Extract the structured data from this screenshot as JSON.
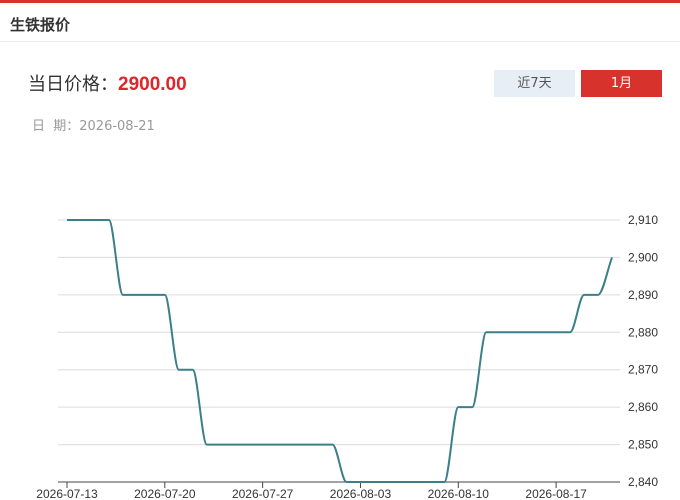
{
  "header": {
    "title": "生铁报价"
  },
  "price": {
    "label": "当日价格：",
    "value": "2900.00"
  },
  "date": {
    "label": "日  期：",
    "value": "2026-08-21"
  },
  "tabs": {
    "week_label": "近7天",
    "month_label": "1月",
    "active": "1月"
  },
  "colors": {
    "accent": "#d7322b",
    "line": "#3a7f8a",
    "price": "#e0252a"
  },
  "chart_data": {
    "type": "line",
    "x": [
      "2026-07-13",
      "2026-07-14",
      "2026-07-15",
      "2026-07-16",
      "2026-07-17",
      "2026-07-18",
      "2026-07-19",
      "2026-07-20",
      "2026-07-21",
      "2026-07-22",
      "2026-07-23",
      "2026-07-24",
      "2026-07-25",
      "2026-07-26",
      "2026-07-27",
      "2026-07-28",
      "2026-07-29",
      "2026-07-30",
      "2026-07-31",
      "2026-08-01",
      "2026-08-02",
      "2026-08-03",
      "2026-08-04",
      "2026-08-05",
      "2026-08-06",
      "2026-08-07",
      "2026-08-08",
      "2026-08-09",
      "2026-08-10",
      "2026-08-11",
      "2026-08-12",
      "2026-08-13",
      "2026-08-14",
      "2026-08-15",
      "2026-08-16",
      "2026-08-17",
      "2026-08-18",
      "2026-08-19",
      "2026-08-20",
      "2026-08-21"
    ],
    "values": [
      2910,
      2910,
      2910,
      2910,
      2890,
      2890,
      2890,
      2890,
      2870,
      2870,
      2850,
      2850,
      2850,
      2850,
      2850,
      2850,
      2850,
      2850,
      2850,
      2850,
      2840,
      2840,
      2840,
      2840,
      2840,
      2840,
      2840,
      2840,
      2860,
      2860,
      2880,
      2880,
      2880,
      2880,
      2880,
      2880,
      2880,
      2890,
      2890,
      2900
    ],
    "x_ticks": [
      "2026-07-13",
      "2026-07-20",
      "2026-07-27",
      "2026-08-03",
      "2026-08-10",
      "2026-08-17"
    ],
    "y_ticks": [
      "2,910",
      "2,900",
      "2,890",
      "2,880",
      "2,870",
      "2,860",
      "2,850",
      "2,840"
    ],
    "ylim": [
      2840,
      2910
    ],
    "grid": true,
    "xlabel": "",
    "ylabel": ""
  }
}
